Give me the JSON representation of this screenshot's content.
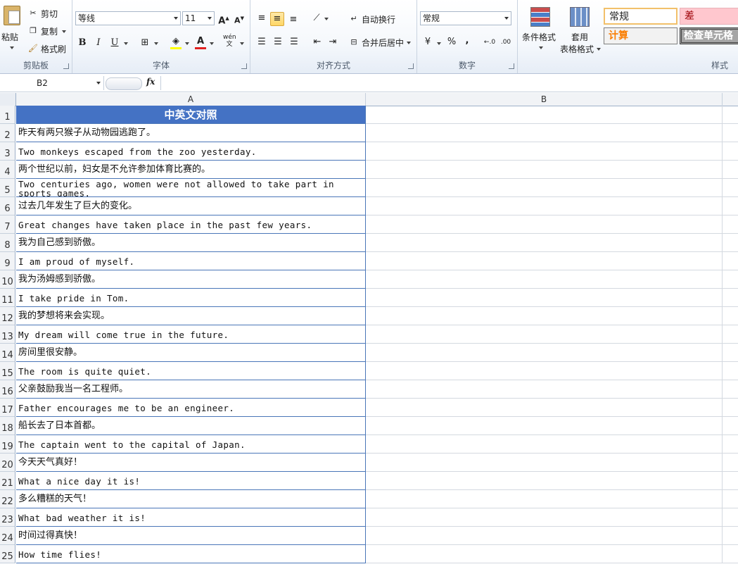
{
  "ribbon": {
    "clipboard": {
      "paste": "粘贴",
      "cut": "剪切",
      "copy": "复制",
      "format_painter": "格式刷",
      "group_label": "剪贴板"
    },
    "font": {
      "font_name": "等线",
      "font_size": "11",
      "group_label": "字体",
      "phonetic": "wén"
    },
    "alignment": {
      "wrap_text": "自动换行",
      "merge_center": "合并后居中",
      "group_label": "对齐方式"
    },
    "number": {
      "format": "常规",
      "percent": "%",
      "comma": ",",
      "group_label": "数字"
    },
    "styles": {
      "conditional": "条件格式",
      "table_style_line1": "套用",
      "table_style_line2": "表格格式",
      "normal": "常规",
      "bad": "差",
      "calc": "计算",
      "check_cell": "检查单元格",
      "group_label": "样式"
    }
  },
  "formula_bar": {
    "name_box": "B2",
    "fx": "fx",
    "formula": ""
  },
  "columns": [
    "A",
    "B"
  ],
  "rows": [
    {
      "num": "1",
      "a": "中英文对照"
    },
    {
      "num": "2",
      "a": "昨天有两只猴子从动物园逃跑了。"
    },
    {
      "num": "3",
      "a": "Two monkeys escaped from the zoo yesterday."
    },
    {
      "num": "4",
      "a": "两个世纪以前，妇女是不允许参加体育比赛的。"
    },
    {
      "num": "5",
      "a": "Two centuries ago, women were not allowed to take part in sports games."
    },
    {
      "num": "6",
      "a": "过去几年发生了巨大的变化。"
    },
    {
      "num": "7",
      "a": "Great changes have taken place in the past few years."
    },
    {
      "num": "8",
      "a": "我为自己感到骄傲。"
    },
    {
      "num": "9",
      "a": "I am proud of myself."
    },
    {
      "num": "10",
      "a": "我为汤姆感到骄傲。"
    },
    {
      "num": "11",
      "a": "I take pride in Tom."
    },
    {
      "num": "12",
      "a": "我的梦想将来会实现。"
    },
    {
      "num": "13",
      "a": "My dream will come true in the future."
    },
    {
      "num": "14",
      "a": "房间里很安静。"
    },
    {
      "num": "15",
      "a": "The room is quite quiet."
    },
    {
      "num": "16",
      "a": "父亲鼓励我当一名工程师。"
    },
    {
      "num": "17",
      "a": "Father encourages me to be an engineer."
    },
    {
      "num": "18",
      "a": "船长去了日本首都。"
    },
    {
      "num": "19",
      "a": "The captain went to the capital of Japan."
    },
    {
      "num": "20",
      "a": "今天天气真好！"
    },
    {
      "num": "21",
      "a": "What a nice day it is!"
    },
    {
      "num": "22",
      "a": "多么糟糕的天气！"
    },
    {
      "num": "23",
      "a": "What bad weather it is!"
    },
    {
      "num": "24",
      "a": "时间过得真快！"
    },
    {
      "num": "25",
      "a": "How time flies!"
    }
  ],
  "colors": {
    "header_fill": "#4472c4",
    "cell_border": "#4a76b8"
  }
}
